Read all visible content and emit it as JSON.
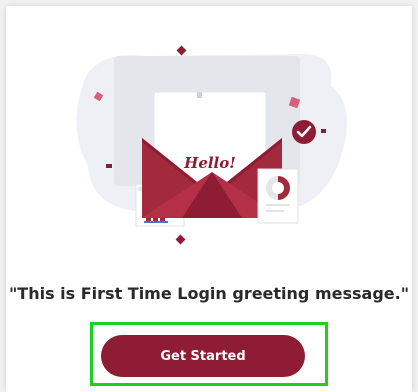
{
  "greeting": {
    "message": "\"This is First Time Login greeting message.\""
  },
  "illustration": {
    "letter_text": "Hello!",
    "icons": [
      "envelope-icon",
      "check-badge-icon",
      "bar-chart-icon",
      "donut-chart-icon"
    ]
  },
  "actions": {
    "get_started_label": "Get Started"
  },
  "colors": {
    "accent": "#8e1c35",
    "accent_light": "#b43046",
    "highlight_border": "#1fd11f"
  }
}
